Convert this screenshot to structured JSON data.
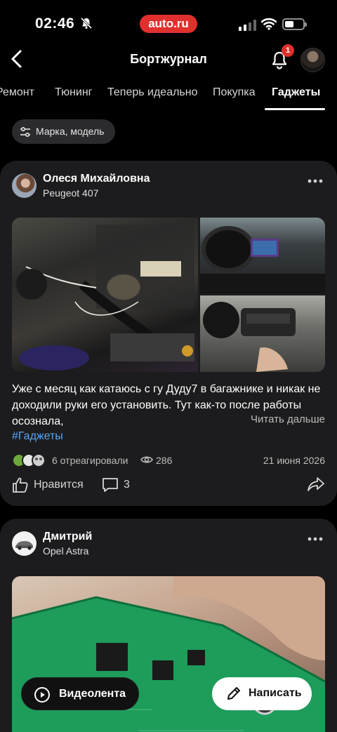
{
  "status_bar": {
    "time": "02:46",
    "brand": "auto.ru"
  },
  "header": {
    "title": "Бортжурнал",
    "notification_count": "1"
  },
  "tabs": [
    {
      "label": "Ремонт",
      "active": false
    },
    {
      "label": "Тюнинг",
      "active": false
    },
    {
      "label": "Теперь идеально",
      "active": false
    },
    {
      "label": "Покупка",
      "active": false
    },
    {
      "label": "Гаджеты",
      "active": true
    }
  ],
  "filter": {
    "label": "Марка, модель"
  },
  "posts": [
    {
      "author": "Олеся Михайловна",
      "car": "Peugeot 407",
      "text": "Уже с месяц как катаюсь с гу Дуду7 в багажнике и никак не доходили руки его установить. Тут как-то после работы осознала,",
      "read_more": "Читать дальше",
      "hashtag": "#Гаджеты",
      "reactions": "6 отреагировали",
      "views": "286",
      "date": "21 июня 2026",
      "like_label": "Нравится",
      "comments": "3"
    },
    {
      "author": "Дмитрий",
      "car": "Opel Astra"
    }
  ],
  "floating": {
    "video_label": "Видеолента",
    "write_label": "Написать"
  },
  "colors": {
    "accent_red": "#e0302e",
    "link_blue": "#5aa6f0",
    "card_bg": "#1c1c1e"
  }
}
